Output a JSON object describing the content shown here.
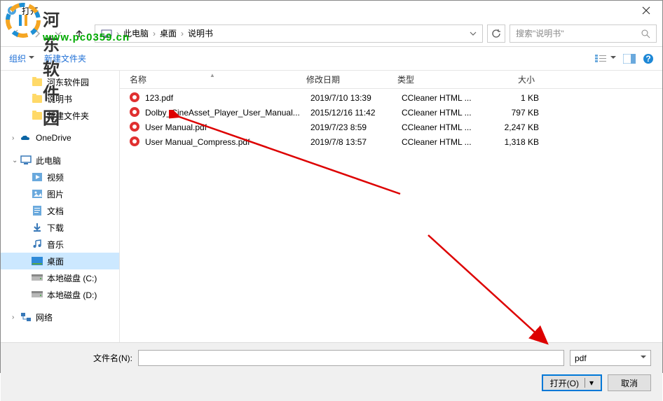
{
  "window": {
    "title": "打开"
  },
  "watermark": {
    "line1": "河东软件园",
    "line2": "www.pc0359.cn"
  },
  "nav": {
    "path": [
      "此电脑",
      "桌面",
      "说明书"
    ],
    "search_placeholder": "搜索\"说明书\""
  },
  "toolbar": {
    "organize": "组织",
    "newfolder": "新建文件夹"
  },
  "sidebar": {
    "items": [
      {
        "label": "河东软件园",
        "type": "folder",
        "lvl": 2
      },
      {
        "label": "说明书",
        "type": "folder",
        "lvl": 2
      },
      {
        "label": "新建文件夹",
        "type": "folder",
        "lvl": 2
      },
      {
        "label": "",
        "type": "gap"
      },
      {
        "label": "OneDrive",
        "type": "onedrive",
        "lvl": 1,
        "exp": "›"
      },
      {
        "label": "",
        "type": "gap"
      },
      {
        "label": "此电脑",
        "type": "pc",
        "lvl": 1,
        "exp": "⌄"
      },
      {
        "label": "视频",
        "type": "video",
        "lvl": 2
      },
      {
        "label": "图片",
        "type": "pics",
        "lvl": 2
      },
      {
        "label": "文档",
        "type": "docs",
        "lvl": 2
      },
      {
        "label": "下载",
        "type": "downloads",
        "lvl": 2
      },
      {
        "label": "音乐",
        "type": "music",
        "lvl": 2
      },
      {
        "label": "桌面",
        "type": "desktop",
        "lvl": 2,
        "selected": true
      },
      {
        "label": "本地磁盘 (C:)",
        "type": "drive",
        "lvl": 2
      },
      {
        "label": "本地磁盘 (D:)",
        "type": "drive",
        "lvl": 2
      },
      {
        "label": "",
        "type": "gap"
      },
      {
        "label": "网络",
        "type": "network",
        "lvl": 1,
        "exp": "›"
      }
    ]
  },
  "columns": {
    "name": "名称",
    "date": "修改日期",
    "type": "类型",
    "size": "大小"
  },
  "files": [
    {
      "name": "123.pdf",
      "date": "2019/7/10 13:39",
      "type": "CCleaner HTML ...",
      "size": "1 KB"
    },
    {
      "name": "Dolby_CineAsset_Player_User_Manual...",
      "date": "2015/12/16 11:42",
      "type": "CCleaner HTML ...",
      "size": "797 KB"
    },
    {
      "name": "User Manual.pdf",
      "date": "2019/7/23 8:59",
      "type": "CCleaner HTML ...",
      "size": "2,247 KB"
    },
    {
      "name": "User Manual_Compress.pdf",
      "date": "2019/7/8 13:57",
      "type": "CCleaner HTML ...",
      "size": "1,318 KB"
    }
  ],
  "bottom": {
    "filename_label": "文件名(N):",
    "filter": "pdf",
    "open": "打开(O)",
    "cancel": "取消"
  }
}
